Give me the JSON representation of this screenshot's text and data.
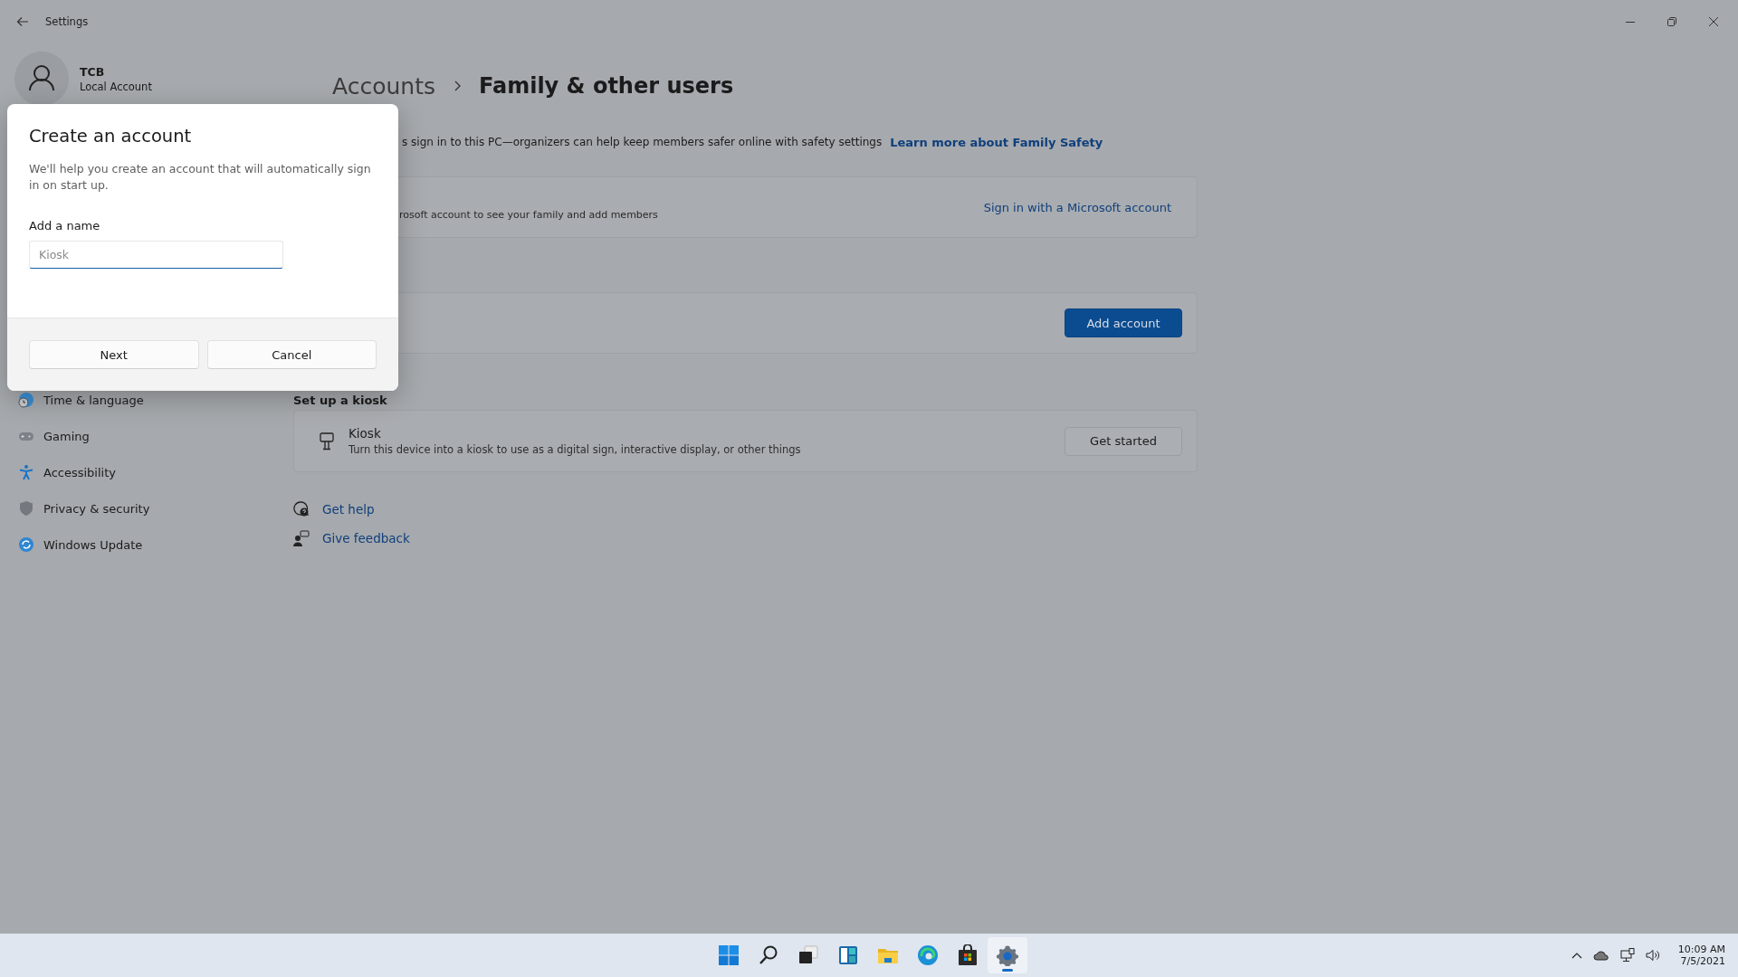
{
  "window": {
    "title": "Settings"
  },
  "profile": {
    "name": "TCB",
    "account_type": "Local Account"
  },
  "nav": [
    {
      "kind": "time",
      "label": "Time & language"
    },
    {
      "kind": "gaming",
      "label": "Gaming"
    },
    {
      "kind": "accessibility",
      "label": "Accessibility"
    },
    {
      "kind": "privacy",
      "label": "Privacy & security"
    },
    {
      "kind": "update",
      "label": "Windows Update"
    }
  ],
  "breadcrumb": {
    "parent": "Accounts",
    "current": "Family & other users"
  },
  "family": {
    "description": "s sign in to this PC—organizers can help keep members safer online with safety settings",
    "link": "Learn more about Family Safety"
  },
  "cards": [
    {
      "kind": "signin",
      "text": "rosoft account to see your family and add members",
      "action": "Sign in with a Microsoft account"
    },
    {
      "kind": "add",
      "action": "Add account"
    }
  ],
  "kiosk": {
    "heading": "Set up a kiosk",
    "title": "Kiosk",
    "description": "Turn this device into a kiosk to use as a digital sign, interactive display, or other things",
    "action": "Get started"
  },
  "help_links": [
    {
      "kind": "help",
      "label": "Get help"
    },
    {
      "kind": "feedback",
      "label": "Give feedback"
    }
  ],
  "dialog": {
    "title": "Create an account",
    "text": "We'll help you create an account that will automatically sign in on start up.",
    "field_label": "Add a name",
    "placeholder": "Kiosk",
    "buttons": [
      "Next",
      "Cancel"
    ]
  },
  "taskbar": {
    "apps": [
      {
        "kind": "start",
        "selected": false
      },
      {
        "kind": "search",
        "selected": false
      },
      {
        "kind": "taskview",
        "selected": false
      },
      {
        "kind": "widgets",
        "selected": false
      },
      {
        "kind": "explorer",
        "selected": false
      },
      {
        "kind": "browser",
        "selected": false
      },
      {
        "kind": "store",
        "selected": false
      },
      {
        "kind": "settings",
        "selected": true
      }
    ],
    "clock": {
      "time": "10:09 AM",
      "date": "7/5/2021"
    }
  }
}
